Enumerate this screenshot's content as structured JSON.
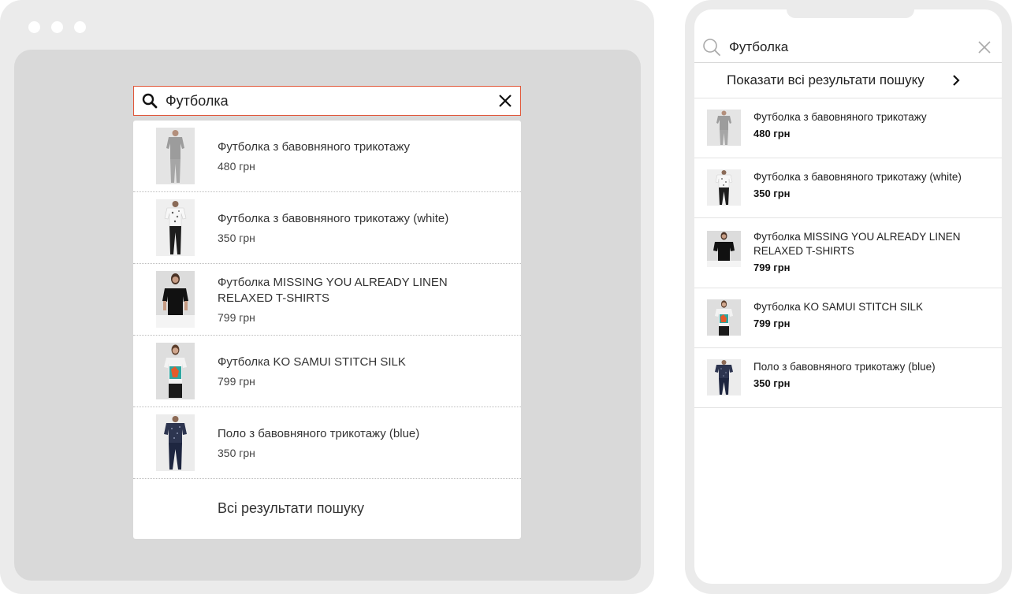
{
  "desktop": {
    "search": {
      "value": "Футболка"
    },
    "results": [
      {
        "title": "Футболка з бавовняного трикотажу",
        "price": "480 грн"
      },
      {
        "title": "Футболка з бавовняного трикотажу (white)",
        "price": "350 грн"
      },
      {
        "title": "Футболка MISSING YOU ALREADY LINEN RELAXED T-SHIRTS",
        "price": "799 грн"
      },
      {
        "title": "Футболка KO SAMUI STITCH SILK",
        "price": "799 грн"
      },
      {
        "title": "Поло з бавовняного трикотажу (blue)",
        "price": "350 грн"
      }
    ],
    "all_results_label": "Всі результати пошуку"
  },
  "mobile": {
    "search": {
      "value": "Футболка"
    },
    "show_all_label": "Показати всі результати пошуку",
    "results": [
      {
        "title": "Футболка з бавовняного трикотажу",
        "price": "480 грн"
      },
      {
        "title": "Футболка з бавовняного трикотажу (white)",
        "price": "350 грн"
      },
      {
        "title": "Футболка MISSING YOU ALREADY LINEN RELAXED T-SHIRTS",
        "price": "799 грн"
      },
      {
        "title": "Футболка KO SAMUI STITCH SILK",
        "price": "799 грн"
      },
      {
        "title": "Поло з бавовняного трикотажу (blue)",
        "price": "350 грн"
      }
    ]
  },
  "colors": {
    "accent": "#e0573a",
    "frame": "#ebebeb",
    "backdrop": "#d9d9d9"
  },
  "icons": [
    "search-icon",
    "close-icon",
    "chevron-right-icon"
  ]
}
